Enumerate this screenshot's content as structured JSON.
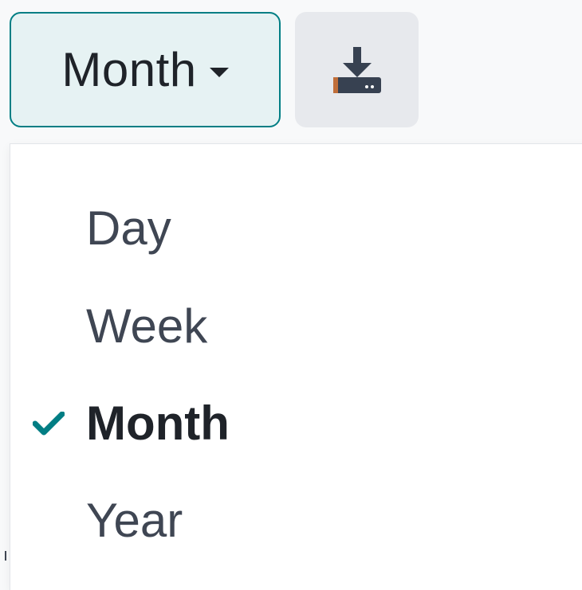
{
  "toolbar": {
    "period_selector": {
      "current_value": "Month",
      "icon": "caret-down-icon"
    },
    "download_button": {
      "icon": "download-icon"
    }
  },
  "dropdown": {
    "items": [
      {
        "label": "Day",
        "selected": false
      },
      {
        "label": "Week",
        "selected": false
      },
      {
        "label": "Month",
        "selected": true,
        "icon": "check-icon"
      },
      {
        "label": "Year",
        "selected": false
      }
    ]
  },
  "colors": {
    "accent": "#017e84",
    "toggle_background": "#e6f2f3",
    "download_background": "#e7e9ed",
    "text_primary": "#1f2329",
    "text_secondary": "#3f4653",
    "menu_background": "#ffffff",
    "page_background": "#f8f9fa"
  }
}
